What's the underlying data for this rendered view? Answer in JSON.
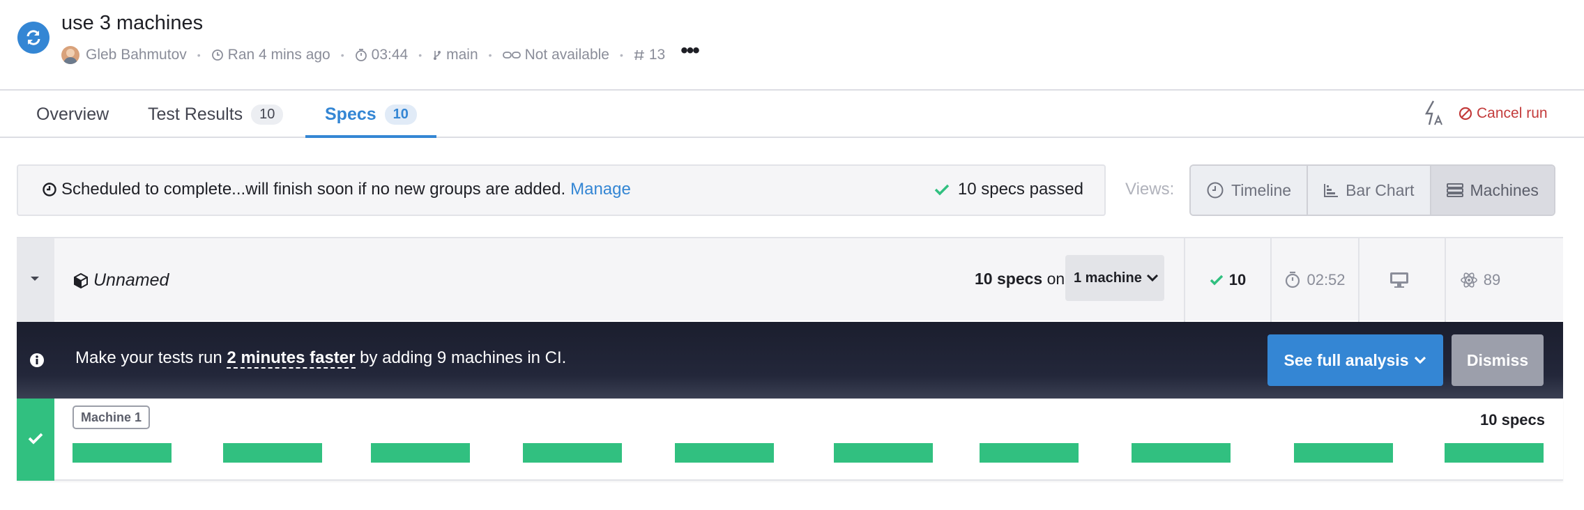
{
  "header": {
    "title": "use 3 machines",
    "author": "Gleb Bahmutov",
    "ran": "Ran 4 mins ago",
    "duration": "03:44",
    "branch": "main",
    "pr": "Not available",
    "run_number": "13"
  },
  "tabs": [
    {
      "label": "Overview",
      "count": ""
    },
    {
      "label": "Test Results",
      "count": "10"
    },
    {
      "label": "Specs",
      "count": "10",
      "active": true
    }
  ],
  "actions": {
    "cancel_run": "Cancel run"
  },
  "infobar": {
    "message": "Scheduled to complete...will finish soon if no new groups are added.",
    "manage": "Manage",
    "passed": "10 specs passed"
  },
  "views": {
    "label": "Views:",
    "options": [
      "Timeline",
      "Bar Chart",
      "Machines"
    ],
    "selected": "Machines"
  },
  "group": {
    "name": "Unnamed",
    "specs_count": "10 specs",
    "on": "on",
    "machines": "1 machine",
    "passed": "10",
    "duration": "02:52",
    "browser_version": "89"
  },
  "banner": {
    "pre": "Make your tests run ",
    "highlight": "2 minutes faster",
    "post": " by adding 9 machines in CI.",
    "analysis_button": "See full analysis",
    "dismiss_button": "Dismiss"
  },
  "machine": {
    "label": "Machine 1",
    "specs": "10 specs",
    "spec_bars": 10
  },
  "colors": {
    "accent": "#3486d4",
    "passed": "#31c080",
    "danger": "#c33b3b",
    "banner": "#1b1e2e"
  }
}
